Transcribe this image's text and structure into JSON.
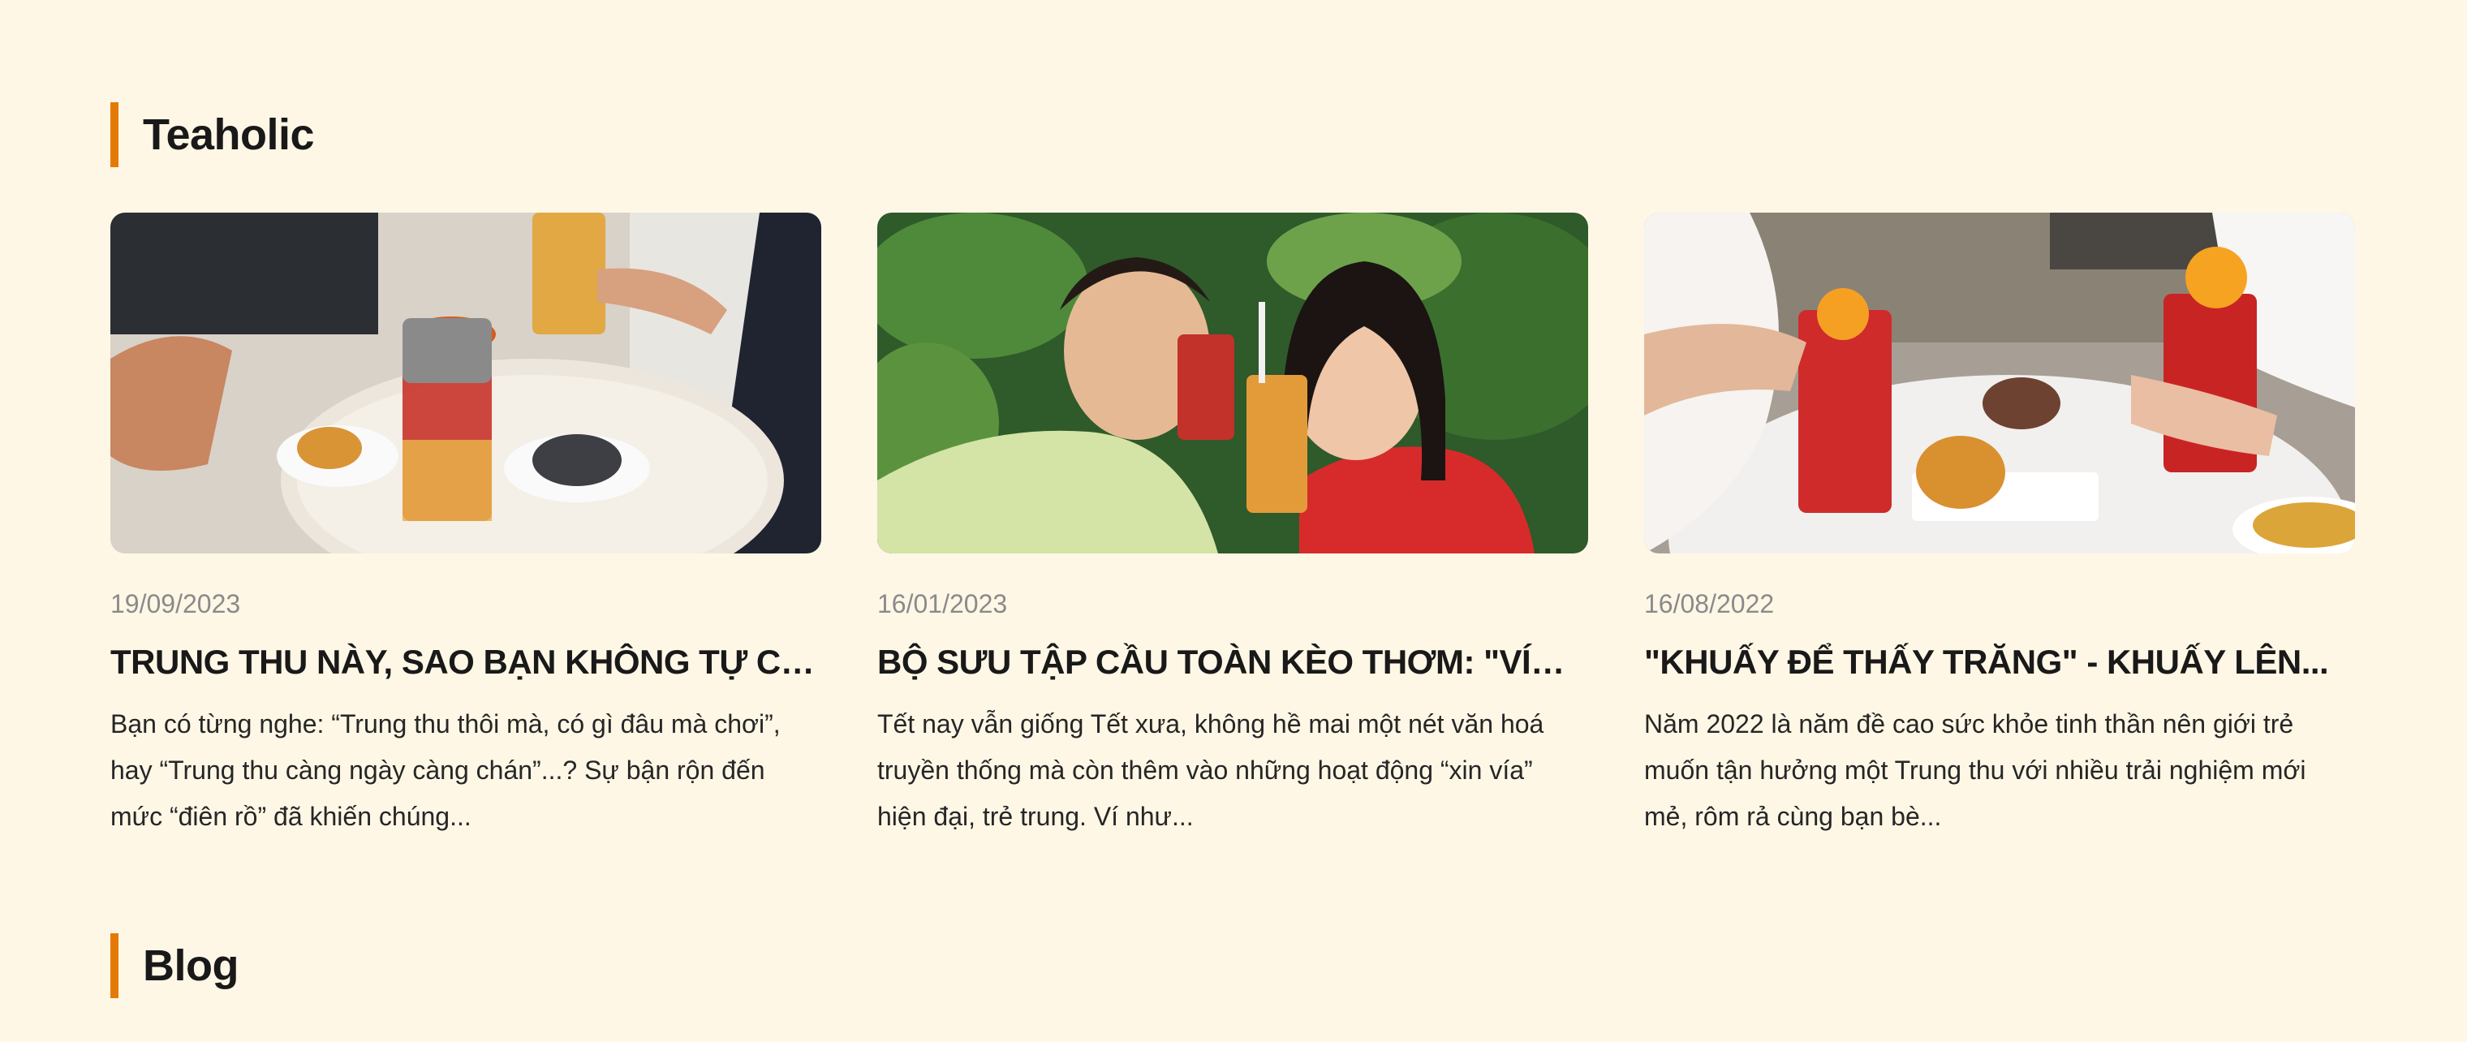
{
  "sections": {
    "teaholic_title": "Teaholic",
    "blog_title": "Blog"
  },
  "colors": {
    "background": "#fff7e6",
    "accent": "#e57905"
  },
  "cards": [
    {
      "date": "19/09/2023",
      "title": "TRUNG THU NÀY, SAO BẠN KHÔNG TỰ CH...",
      "excerpt": "Bạn có từng nghe: “Trung thu thôi mà, có gì đâu mà chơi”, hay “Trung thu càng ngày càng chán”...? Sự bận rộn đến mức “điên rồ” đã khiến chúng...",
      "image_label": "tea-mooncake-table-image"
    },
    {
      "date": "16/01/2023",
      "title": "BỘ SƯU TẬP CẦU TOÀN KÈO THƠM: \"VÍA\"...",
      "excerpt": "Tết nay vẫn giống Tết xưa, không hề mai một nét văn hoá truyền thống mà còn thêm vào những hoạt động “xin vía” hiện đại, trẻ trung. Ví như...",
      "image_label": "couple-with-drinks-image"
    },
    {
      "date": "16/08/2022",
      "title": "\"KHUẤY ĐỂ THẤY TRĂNG\" - KHUẤY LÊN...",
      "excerpt": "Năm 2022 là năm đề cao sức khỏe tinh thần nên giới trẻ muốn tận hưởng một Trung thu với nhiều trải nghiệm mới mẻ, rôm rả cùng bạn bè...",
      "image_label": "red-tea-mooncake-image"
    }
  ]
}
